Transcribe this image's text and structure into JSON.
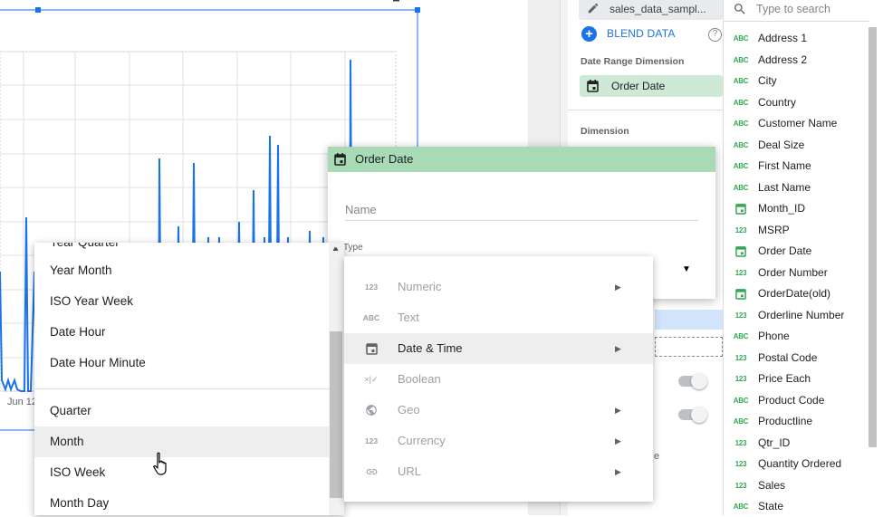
{
  "chart": {
    "x_tick_label": "Jun 12"
  },
  "data_panel": {
    "data_source": "sales_data_sampl...",
    "blend_label": "BLEND DATA",
    "date_range_label": "Date Range Dimension",
    "date_range_value": "Order Date",
    "dimension_label": "Dimension"
  },
  "field_list": {
    "search_placeholder": "Type to search",
    "fields": [
      {
        "type": "ABC",
        "name": "Address 1"
      },
      {
        "type": "ABC",
        "name": "Address 2"
      },
      {
        "type": "ABC",
        "name": "City"
      },
      {
        "type": "ABC",
        "name": "Country"
      },
      {
        "type": "ABC",
        "name": "Customer Name"
      },
      {
        "type": "ABC",
        "name": "Deal Size"
      },
      {
        "type": "ABC",
        "name": "First Name"
      },
      {
        "type": "ABC",
        "name": "Last Name"
      },
      {
        "type": "date",
        "name": "Month_ID"
      },
      {
        "type": "123",
        "name": "MSRP"
      },
      {
        "type": "date",
        "name": "Order Date"
      },
      {
        "type": "123",
        "name": "Order Number"
      },
      {
        "type": "date",
        "name": "OrderDate(old)"
      },
      {
        "type": "123",
        "name": "Orderline Number"
      },
      {
        "type": "ABC",
        "name": "Phone"
      },
      {
        "type": "123",
        "name": "Postal Code"
      },
      {
        "type": "123",
        "name": "Price Each"
      },
      {
        "type": "ABC",
        "name": "Product Code"
      },
      {
        "type": "ABC",
        "name": "Productline"
      },
      {
        "type": "123",
        "name": "Qtr_ID"
      },
      {
        "type": "123",
        "name": "Quantity Ordered"
      },
      {
        "type": "123",
        "name": "Sales"
      },
      {
        "type": "ABC",
        "name": "State"
      }
    ]
  },
  "field_editor": {
    "title": "Order Date",
    "name_placeholder": "Name",
    "type_label": "Type"
  },
  "type_menu": {
    "items": [
      {
        "icon": "123",
        "label": "Numeric",
        "submenu": true
      },
      {
        "icon": "ABC",
        "label": "Text",
        "submenu": false
      },
      {
        "icon": "calendar",
        "label": "Date & Time",
        "submenu": true,
        "active": true
      },
      {
        "icon": "bool",
        "label": "Boolean",
        "submenu": false
      },
      {
        "icon": "globe",
        "label": "Geo",
        "submenu": true
      },
      {
        "icon": "123",
        "label": "Currency",
        "submenu": true
      },
      {
        "icon": "link",
        "label": "URL",
        "submenu": true
      }
    ]
  },
  "date_menu": {
    "items": [
      {
        "label": "Year Quarter"
      },
      {
        "label": "Year Month"
      },
      {
        "label": "ISO Year Week"
      },
      {
        "label": "Date Hour"
      },
      {
        "label": "Date Hour Minute"
      },
      {
        "label": "Quarter"
      },
      {
        "label": "Month",
        "active": true
      },
      {
        "label": "ISO Week"
      },
      {
        "label": "Month Day"
      }
    ]
  },
  "colors": {
    "line": "#1a73e8",
    "date_chip": "#ceead6",
    "header_green": "#a8dab5",
    "field_icon_green": "#34a853",
    "link_blue": "#1a73e8"
  }
}
